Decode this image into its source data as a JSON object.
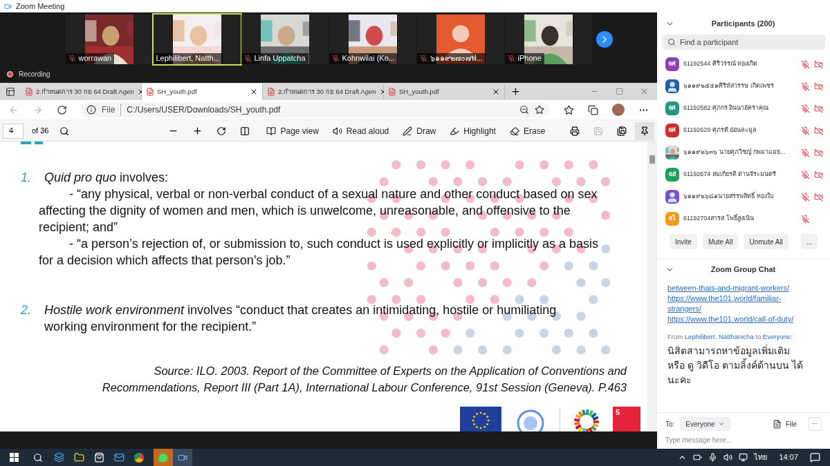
{
  "window": {
    "title": "Zoom Meeting"
  },
  "videos": [
    {
      "name": "worrawan",
      "muted": true,
      "speaking": false,
      "kind": "picture"
    },
    {
      "name": "Lephilibert, Natth...",
      "muted": false,
      "speaking": true,
      "kind": "picture"
    },
    {
      "name": "Linfa Uppatcha",
      "muted": true,
      "speaking": false,
      "kind": "picture"
    },
    {
      "name": "Kohnwilai (Ko...",
      "muted": true,
      "speaking": false,
      "kind": "picture"
    },
    {
      "name": "๖๑๑๙๒๗๐๗ฟ...",
      "muted": true,
      "speaking": false,
      "kind": "avatar"
    },
    {
      "name": "iPhone",
      "muted": true,
      "speaking": false,
      "kind": "picture"
    }
  ],
  "recording": "Recording",
  "browser": {
    "tabs": [
      {
        "title": "2.กำหนดการ 30 กย 64 Draft Agen",
        "selected": false
      },
      {
        "title": "SH_youth.pdf",
        "selected": true
      },
      {
        "title": "2.กำหนดการ 30 กย 64 Draft Agen",
        "selected": false
      },
      {
        "title": "SH_youth.pdf",
        "selected": false
      }
    ],
    "address_scheme": "File",
    "address": "C:/Users/USER/Downloads/SH_youth.pdf",
    "pdf_toolbar": {
      "page": "4",
      "page_count": "of 36",
      "tools": [
        "Page view",
        "Read aloud",
        "Draw",
        "Highlight",
        "Erase"
      ]
    },
    "document": {
      "items": [
        {
          "number": "1.",
          "text": "*Quid pro quo* involves:",
          "quotes": [
            "- “any physical, verbal or non-verbal conduct of a sexual nature and other conduct based on sex affecting the dignity of women and men, which is unwelcome, unreasonable, and offensive to the recipient; and”",
            "- “a person’s rejection of, or submission to, such conduct is used explicitly or implicitly as a basis for a decision which affects that person’s job.”"
          ]
        },
        {
          "number": "2.",
          "text": "*Hostile work environment* involves “conduct that creates an intimidating, hostile or humiliating working environment for the recipient.”"
        }
      ],
      "source": "Source: ILO. 2003. Report of the Committee of Experts on the Application of Conventions and Recommendations, Report III (Part 1A), International Labour Conference, 91st Session (Geneva). P.463",
      "sdg_number": "5"
    }
  },
  "participants": {
    "title": "Participants (200)",
    "search_placeholder": "Find a participant",
    "list": [
      {
        "avatar": "6ศ",
        "kind": "initials",
        "color": "#8e3fb5",
        "name": "61192544 ศิริวรรณ์ ทองเกิด",
        "video_off": true
      },
      {
        "kind": "person",
        "color": "#1f5fa8",
        "name": "๖๑๑๙๒๕๕๑ศิริห์สวรรษ เกิดเพชร",
        "video_off": true
      },
      {
        "avatar": "6ศ",
        "kind": "initials",
        "color": "#1d9a78",
        "name": "61192582 ศุภกร อินนาอัคราคุณ",
        "video_off": true
      },
      {
        "avatar": "6ศ",
        "kind": "initials",
        "color": "#c9302c",
        "name": "61192629 ศุภรดี อ่อนละมูล",
        "video_off": true
      },
      {
        "kind": "picture",
        "name": "๖๑๑๙๒๖๓๖ นายศุภวิชญ์ กพมาแม่ธ...",
        "video_off": true
      },
      {
        "avatar": "6ส",
        "kind": "initials",
        "color": "#1e9e5a",
        "name": "61192674 สมเกียรติ ด่านจีระมนตรี",
        "video_off": true
      },
      {
        "kind": "person",
        "color": "#7a4fc9",
        "name": "๖๑๑๙๒๖๘๑นายสรรพสิทธิ์ ทองใบ",
        "video_off": true
      },
      {
        "avatar": "6ไ",
        "kind": "initials",
        "color": "#f29a1c",
        "name": "61192704สารส โพธิ์สูงเนิน",
        "video_off": false
      }
    ],
    "buttons": [
      "Invite",
      "Mute All",
      "Unmute All",
      "..."
    ]
  },
  "chat": {
    "title": "Zoom Group Chat",
    "links": [
      "between-thais-and-migrant-workers/",
      "https://www.the101.world/familiar-strangers/",
      "https://www.the101.world/call-of-duty/"
    ],
    "message": {
      "from_label": "From",
      "sender": "Lephilibert, Natthanicha",
      "to_label": "to",
      "recipient": "Everyone:",
      "text": "นิสิตสามารถหาข้อมูลเพิ่มเติม หรือ ดู วิดีโอ ตามลิ้งค์ด้านบน ได้นะคะ"
    },
    "to_label": "To:",
    "to_value": "Everyone",
    "file_label": "File",
    "more": "···",
    "input_placeholder": "Type message here..."
  },
  "taskbar": {
    "language": "ไทย",
    "time": "14:07"
  }
}
